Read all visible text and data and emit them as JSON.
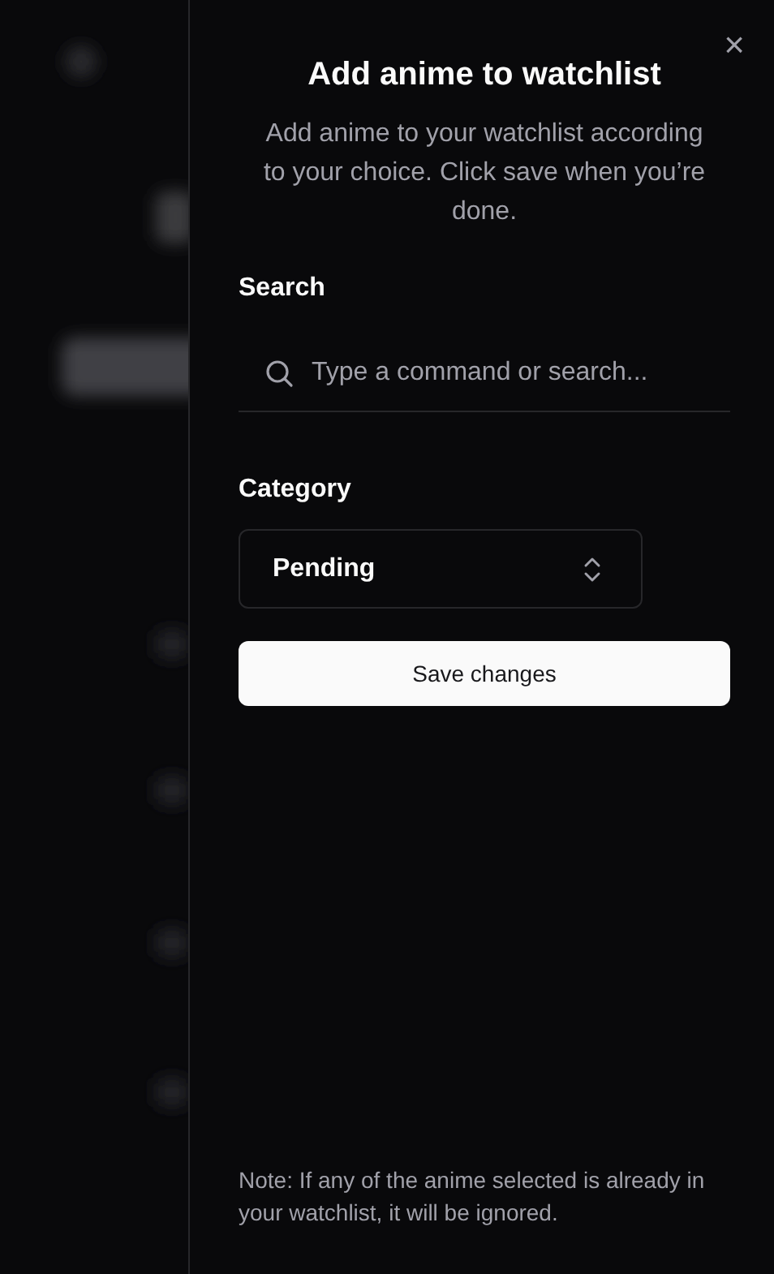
{
  "dialog": {
    "title": "Add anime to watchlist",
    "description": "Add anime to your watchlist according to your choice. Click save when you’re done.",
    "close": "×"
  },
  "search": {
    "label": "Search",
    "placeholder": "Type a command or search..."
  },
  "category": {
    "label": "Category",
    "value": "Pending"
  },
  "save_button": "Save changes",
  "note": "Note: If any of the anime selected is already in your watchlist, it will be ignored."
}
